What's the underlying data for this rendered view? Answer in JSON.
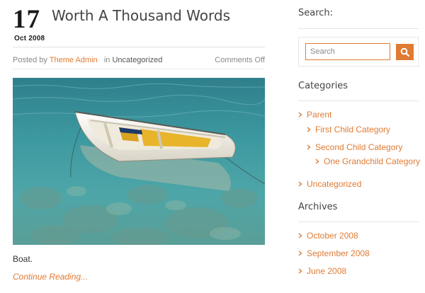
{
  "post": {
    "day": "17",
    "month": "Oct 2008",
    "title": "Worth A Thousand Words",
    "posted_by": "Posted by",
    "author": "Theme Admin",
    "in": "in",
    "category": "Uncategorized",
    "comments": "Comments Off",
    "excerpt": "Boat.",
    "continue": "Continue Reading..."
  },
  "sidebar": {
    "search_title": "Search:",
    "search_placeholder": "Search",
    "categories_title": "Categories",
    "categories": [
      {
        "label": "Parent",
        "level": 0
      },
      {
        "label": "First Child Category",
        "level": 1
      },
      {
        "label": "Second Child Category",
        "level": 1
      },
      {
        "label": "One Grandchild Category",
        "level": 2
      },
      {
        "label": "Uncategorized",
        "level": 0
      }
    ],
    "archives_title": "Archives",
    "archives": [
      {
        "label": "October 2008"
      },
      {
        "label": "September 2008"
      },
      {
        "label": "June 2008"
      }
    ]
  },
  "colors": {
    "accent": "#e07b33",
    "text": "#444444",
    "muted": "#888888"
  },
  "icons": {
    "search_button": "search-icon",
    "list_bullet": "chevron-right-icon"
  }
}
